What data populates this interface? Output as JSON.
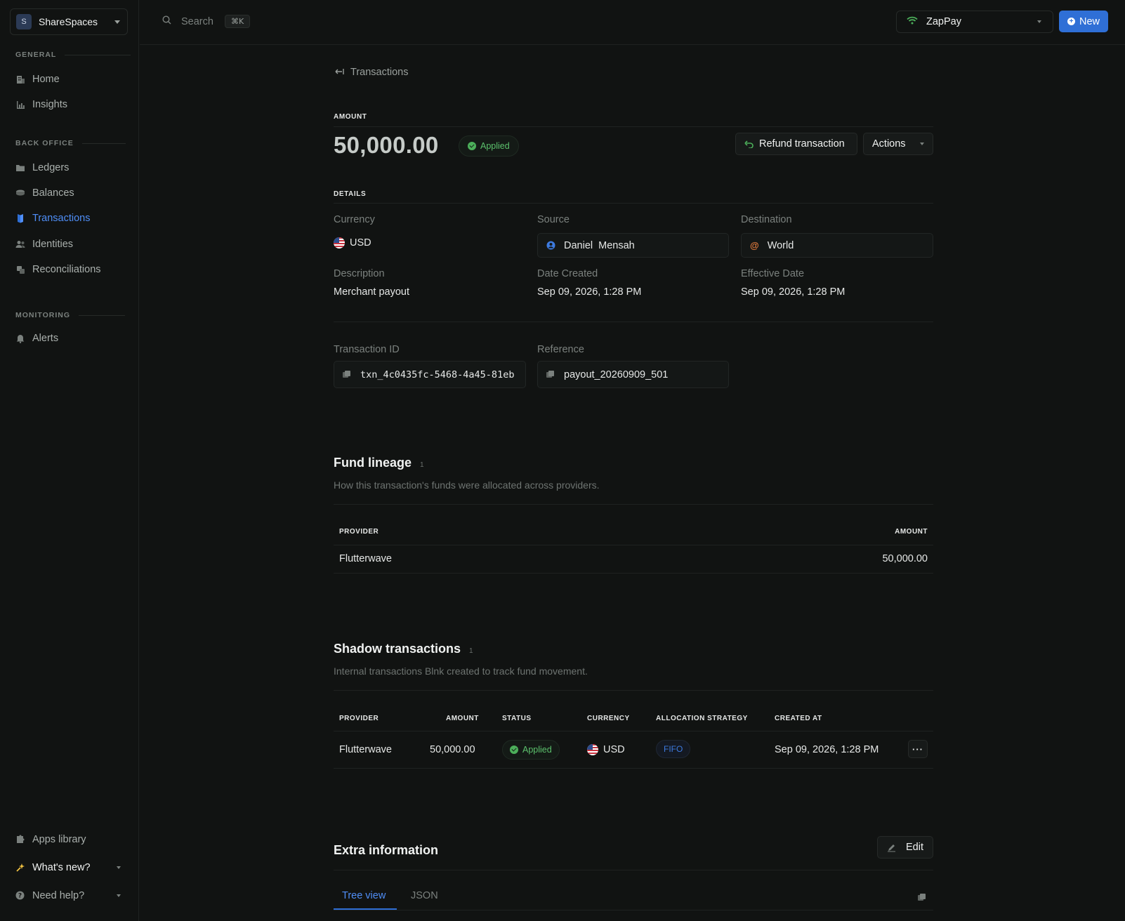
{
  "sidebar": {
    "workspace": {
      "initial": "S",
      "name": "ShareSpaces"
    },
    "sections": [
      {
        "label": "GENERAL",
        "items": [
          {
            "label": "Home",
            "icon": "building-icon"
          },
          {
            "label": "Insights",
            "icon": "bar-chart-icon"
          }
        ]
      },
      {
        "label": "BACK OFFICE",
        "items": [
          {
            "label": "Ledgers",
            "icon": "folder-icon"
          },
          {
            "label": "Balances",
            "icon": "coins-icon"
          },
          {
            "label": "Transactions",
            "icon": "transactions-icon",
            "active": true
          },
          {
            "label": "Identities",
            "icon": "users-icon"
          },
          {
            "label": "Reconciliations",
            "icon": "reconcile-icon"
          }
        ]
      },
      {
        "label": "MONITORING",
        "items": [
          {
            "label": "Alerts",
            "icon": "bell-icon"
          }
        ]
      }
    ],
    "bottom": [
      {
        "label": "Apps library",
        "icon": "puzzle-icon"
      },
      {
        "label": "What's new?",
        "icon": "sparkle-icon"
      },
      {
        "label": "Need help?",
        "icon": "help-icon"
      }
    ]
  },
  "topbar": {
    "search_placeholder": "Search",
    "shortcut": "⌘K",
    "org_name": "ZapPay",
    "new_label": "New"
  },
  "back_label": "Transactions",
  "amount": {
    "caption": "AMOUNT",
    "value": "50,000.00",
    "status": "Applied",
    "refund_label": "Refund transaction",
    "actions_label": "Actions"
  },
  "details": {
    "caption": "DETAILS",
    "currency_label": "Currency",
    "currency_value": "USD",
    "source_label": "Source",
    "source_value": "Daniel  Mensah",
    "destination_label": "Destination",
    "destination_value": "World",
    "description_label": "Description",
    "description_value": "Merchant payout",
    "date_created_label": "Date Created",
    "date_created_value": "Sep 09, 2026, 1:28 PM",
    "effective_date_label": "Effective Date",
    "effective_date_value": "Sep 09, 2026, 1:28 PM",
    "transaction_id_label": "Transaction ID",
    "transaction_id_value": "txn_4c0435fc-5468-4a45-81eb",
    "reference_label": "Reference",
    "reference_value": "payout_20260909_501"
  },
  "fund_lineage": {
    "title": "Fund lineage",
    "count": "1",
    "description": "How this transaction's funds were allocated across providers.",
    "columns": [
      "PROVIDER",
      "AMOUNT"
    ],
    "rows": [
      {
        "provider": "Flutterwave",
        "amount": "50,000.00"
      }
    ]
  },
  "shadow": {
    "title": "Shadow transactions",
    "count": "1",
    "description": "Internal transactions Blnk created to track fund movement.",
    "columns": [
      "PROVIDER",
      "AMOUNT",
      "STATUS",
      "CURRENCY",
      "ALLOCATION STRATEGY",
      "CREATED AT"
    ],
    "rows": [
      {
        "provider": "Flutterwave",
        "amount": "50,000.00",
        "status": "Applied",
        "currency": "USD",
        "strategy": "FIFO",
        "created_at": "Sep 09, 2026, 1:28 PM"
      }
    ]
  },
  "extra": {
    "title": "Extra information",
    "edit_label": "Edit",
    "tabs": [
      {
        "label": "Tree view",
        "active": true
      },
      {
        "label": "JSON",
        "active": false
      }
    ]
  },
  "colors": {
    "accent": "#2f6fd6",
    "success": "#5cc26d",
    "background": "#111312"
  }
}
